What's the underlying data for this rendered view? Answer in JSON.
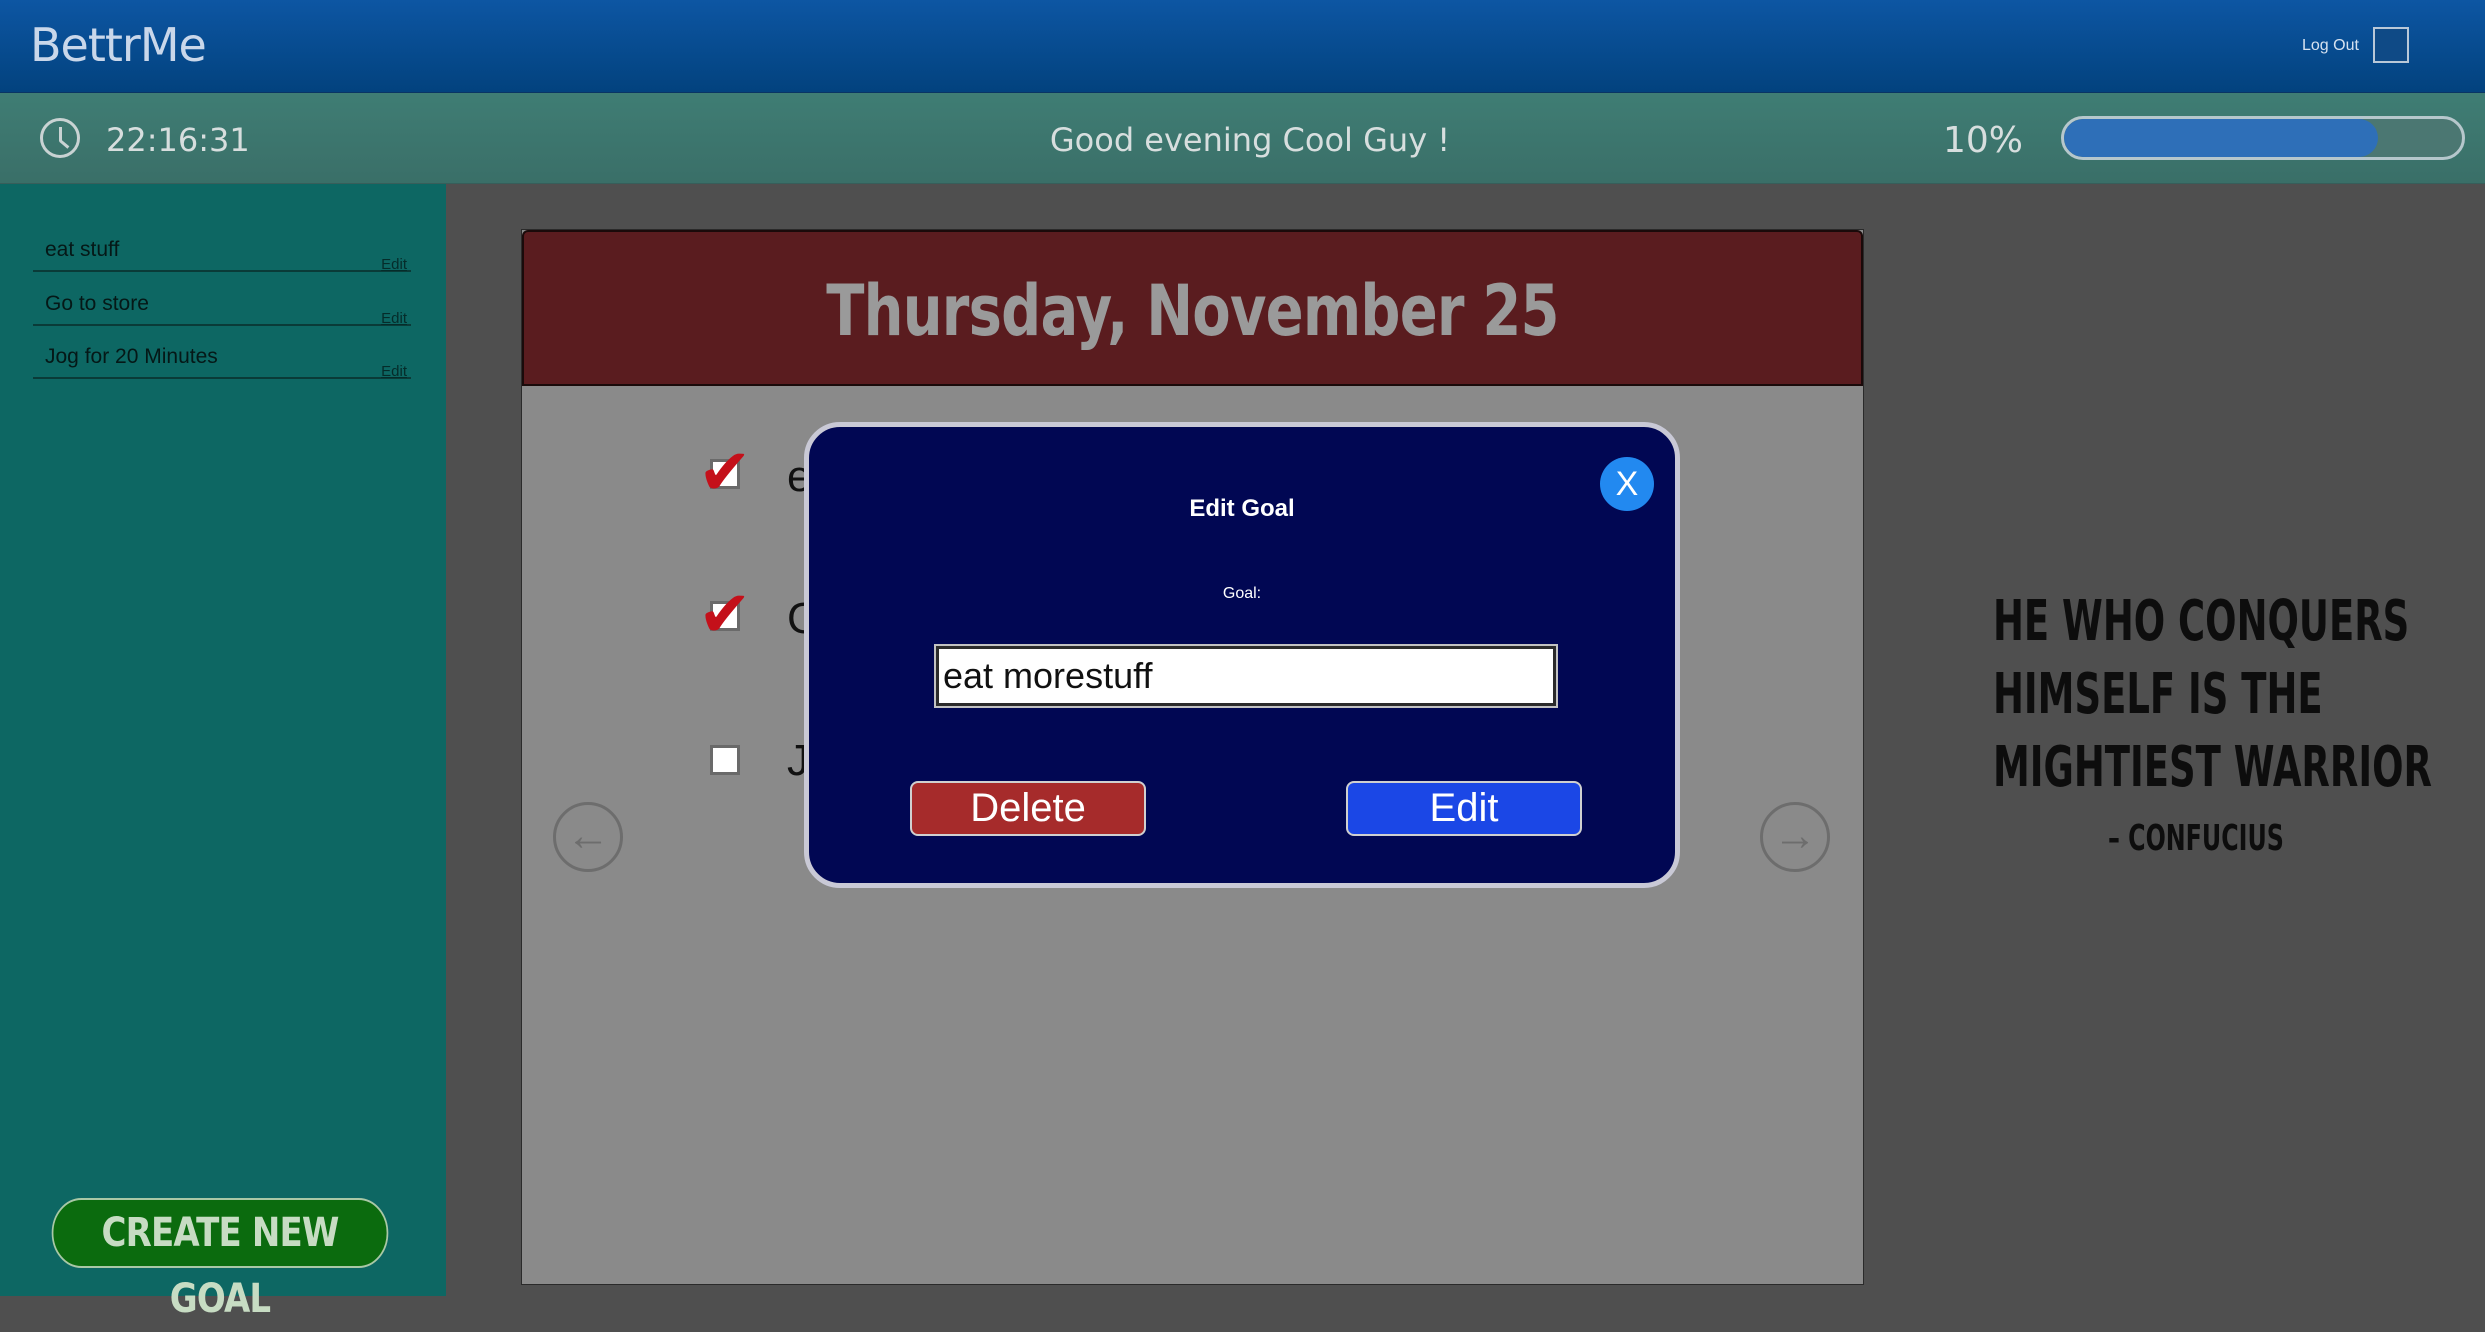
{
  "header": {
    "brand": "BettrMe",
    "logout_label": "Log Out"
  },
  "status": {
    "time": "22:16:31",
    "greeting": "Good evening Cool Guy !",
    "progress_text": "10%",
    "progress_fill_fraction": 0.79
  },
  "sidebar": {
    "goals": [
      {
        "label": "eat stuff",
        "edit": "Edit"
      },
      {
        "label": "Go to store",
        "edit": "Edit"
      },
      {
        "label": "Jog for 20 Minutes",
        "edit": "Edit"
      }
    ],
    "create_button": "CREATE NEW GOAL"
  },
  "calendar": {
    "date": "Thursday, November 25",
    "tasks": [
      {
        "letter": "e",
        "checked": true
      },
      {
        "letter": "G",
        "checked": true
      },
      {
        "letter": "J",
        "checked": false
      }
    ],
    "prev_icon": "arrow-left-icon",
    "next_icon": "arrow-right-icon"
  },
  "quote": {
    "lines": [
      "He who conquers",
      "himself is the",
      "mightiest warrior"
    ],
    "author": "– CONFUCIUS"
  },
  "modal": {
    "close_label": "X",
    "title": "Edit Goal",
    "field_label": "Goal:",
    "input_value": "eat morestuff",
    "delete_label": "Delete",
    "edit_label": "Edit"
  },
  "colors": {
    "topbar": "#02427e",
    "statusbar": "#3f7d74",
    "sidebar": "#0d6763",
    "calendar_header": "#5a1c1f",
    "modal_bg": "#010753",
    "delete": "#a62b2b",
    "edit": "#1b47e6",
    "check": "#c4101a"
  }
}
